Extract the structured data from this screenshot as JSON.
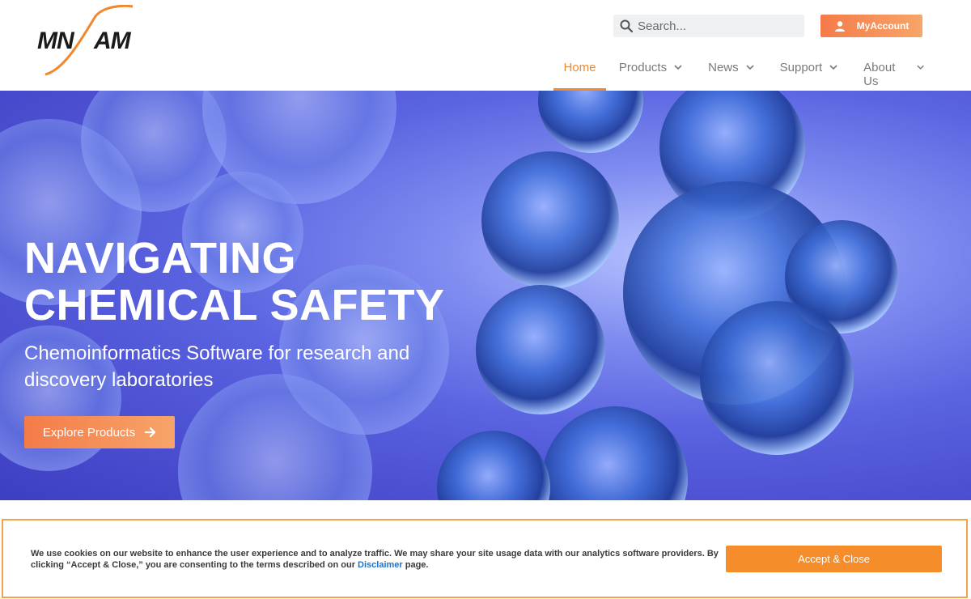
{
  "brand": {
    "logo_text": "MNAM",
    "accent_color": "#f0882f",
    "button_gradient": [
      "#f47b49",
      "#f7a56a"
    ]
  },
  "header": {
    "search": {
      "placeholder": "Search...",
      "icon": "search-icon"
    },
    "account_button": {
      "label": "MyAccount",
      "icon": "user-icon"
    },
    "nav": [
      {
        "label": "Home",
        "active": true
      },
      {
        "label": "Products",
        "has_dropdown": true
      },
      {
        "label": "News",
        "has_dropdown": true
      },
      {
        "label": "Support",
        "has_dropdown": true
      },
      {
        "label": "About Us",
        "has_dropdown": true
      }
    ]
  },
  "hero": {
    "title_line1": "NAVIGATING",
    "title_line2": "CHEMICAL SAFETY",
    "subtitle": "Chemoinformatics Software for research and discovery laboratories",
    "cta": {
      "label": "Explore Products",
      "icon": "arrow-right-icon"
    }
  },
  "cookie_banner": {
    "text_before_link": "We use cookies on our website to enhance the user experience and to analyze traffic. We may share your site usage data with our analytics software providers. By clicking “Accept & Close,” you are consenting to the terms described on our ",
    "link_text": "Disclaimer",
    "text_after_link": " page.",
    "accept_label": "Accept & Close",
    "border_color": "#f0a348",
    "button_color": "#f58d2a"
  }
}
